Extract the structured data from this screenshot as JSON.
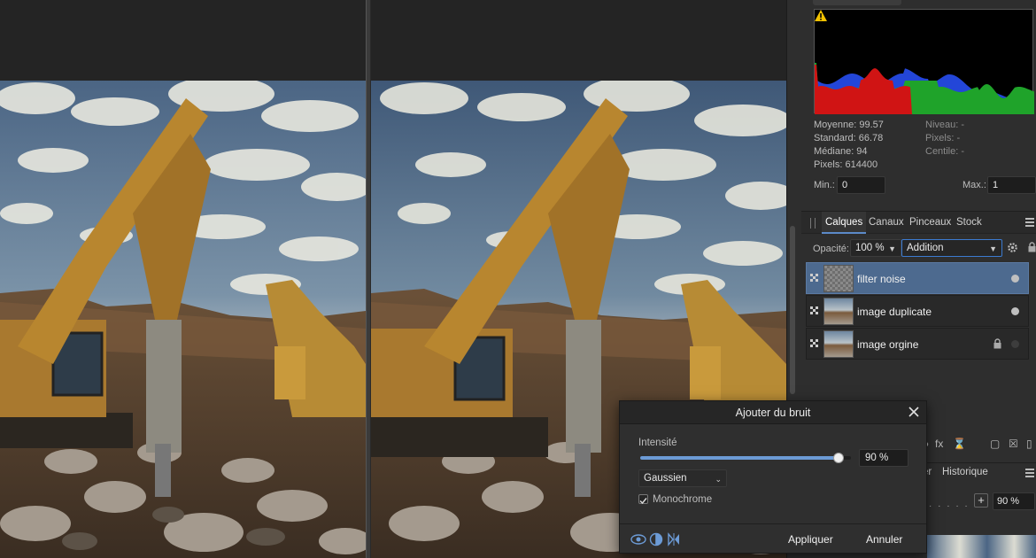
{
  "histogram": {
    "warning_icon": "warning-triangle-icon",
    "stats_left": [
      "Moyenne: 99.57",
      "Standard: 66.78",
      "Médiane: 94",
      "Pixels: 614400"
    ],
    "stats_right": [
      "Niveau: -",
      "Pixels: -",
      "Centile: -"
    ],
    "min_label": "Min.:",
    "min_value": "0",
    "max_label": "Max.:",
    "max_value": "1",
    "colors": {
      "red": "#d01414",
      "green": "#1fa32a",
      "blue": "#2346d8"
    }
  },
  "panel_tabs": [
    "Calques",
    "Canaux",
    "Pinceaux",
    "Stock"
  ],
  "layers_panel": {
    "opacity_label": "Opacité:",
    "opacity_value": "100 %",
    "blend_mode": "Addition"
  },
  "layers": [
    {
      "name": "filter noise",
      "selected": true,
      "locked": false
    },
    {
      "name": "image duplicate",
      "selected": false,
      "locked": false
    },
    {
      "name": "image orgine",
      "selected": false,
      "locked": true
    }
  ],
  "lower_panel": {
    "tab_partial": "er",
    "tab_history": "Historique",
    "zoom_value": "90 %"
  },
  "dialog": {
    "title": "Ajouter du bruit",
    "intensity_label": "Intensité",
    "intensity_value": "90 %",
    "intensity_fraction": 0.9,
    "distribution": "Gaussien",
    "monochrome_label": "Monochrome",
    "monochrome_checked": true,
    "apply_label": "Appliquer",
    "cancel_label": "Annuler"
  },
  "accent_color": "#4d6a8f"
}
